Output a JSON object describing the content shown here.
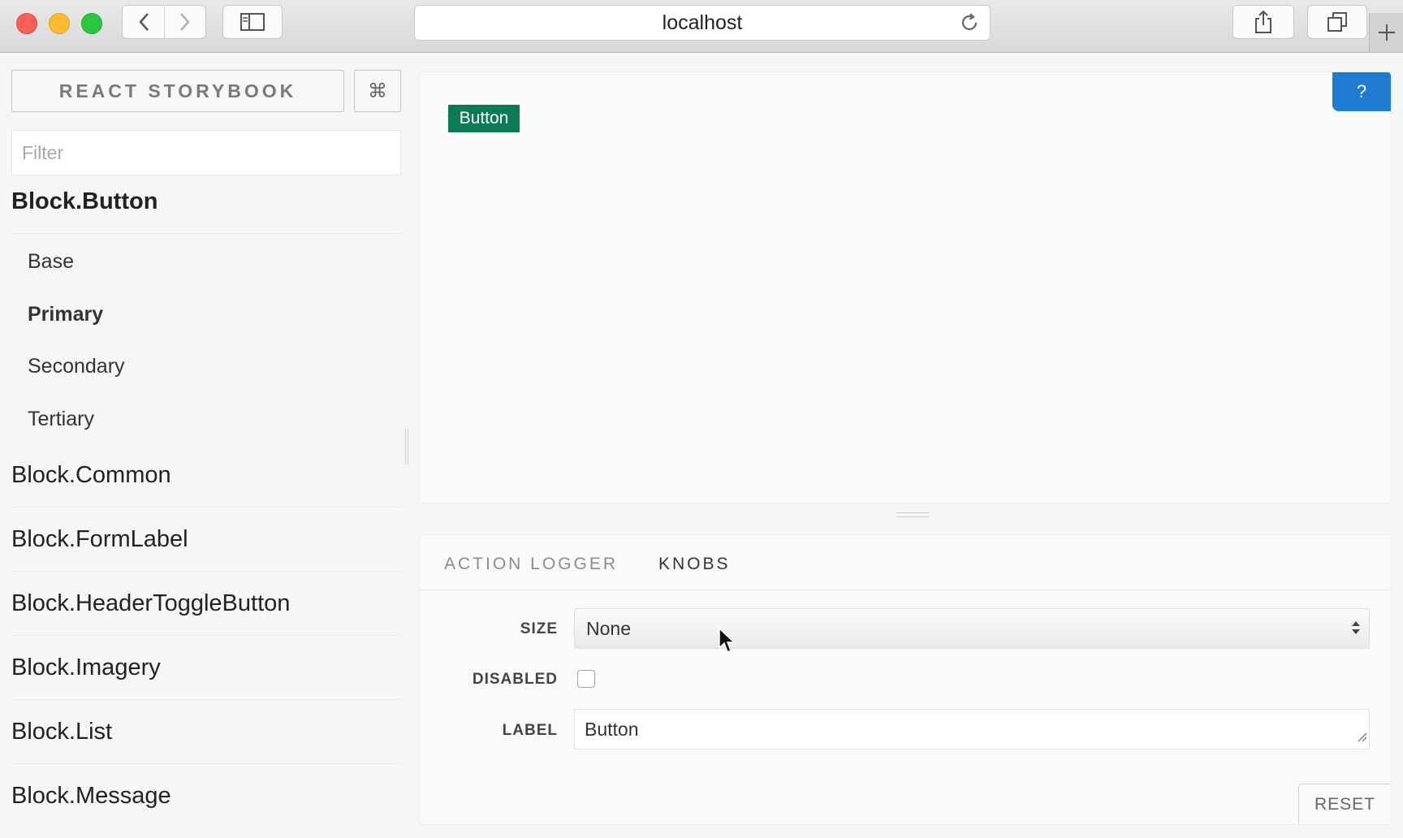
{
  "browser": {
    "url": "localhost"
  },
  "sidebar": {
    "brand": "REACT STORYBOOK",
    "shortcut_symbol": "⌘",
    "filter_placeholder": "Filter",
    "kinds": [
      {
        "name": "Block.Button",
        "active": true,
        "stories": [
          {
            "name": "Base",
            "active": false
          },
          {
            "name": "Primary",
            "active": true
          },
          {
            "name": "Secondary",
            "active": false
          },
          {
            "name": "Tertiary",
            "active": false
          }
        ]
      },
      {
        "name": "Block.Common"
      },
      {
        "name": "Block.FormLabel"
      },
      {
        "name": "Block.HeaderToggleButton"
      },
      {
        "name": "Block.Imagery"
      },
      {
        "name": "Block.List"
      },
      {
        "name": "Block.Message"
      }
    ]
  },
  "preview": {
    "button_label": "Button",
    "button_color": "#0b7a57",
    "help_label": "?",
    "help_color": "#1f7bd1"
  },
  "addons": {
    "tabs": [
      "ACTION LOGGER",
      "KNOBS"
    ],
    "active_tab": "KNOBS",
    "knobs": {
      "size_label": "SIZE",
      "size_value": "None",
      "disabled_label": "DISABLED",
      "disabled_checked": false,
      "label_label": "LABEL",
      "label_value": "Button"
    },
    "reset_label": "RESET"
  }
}
